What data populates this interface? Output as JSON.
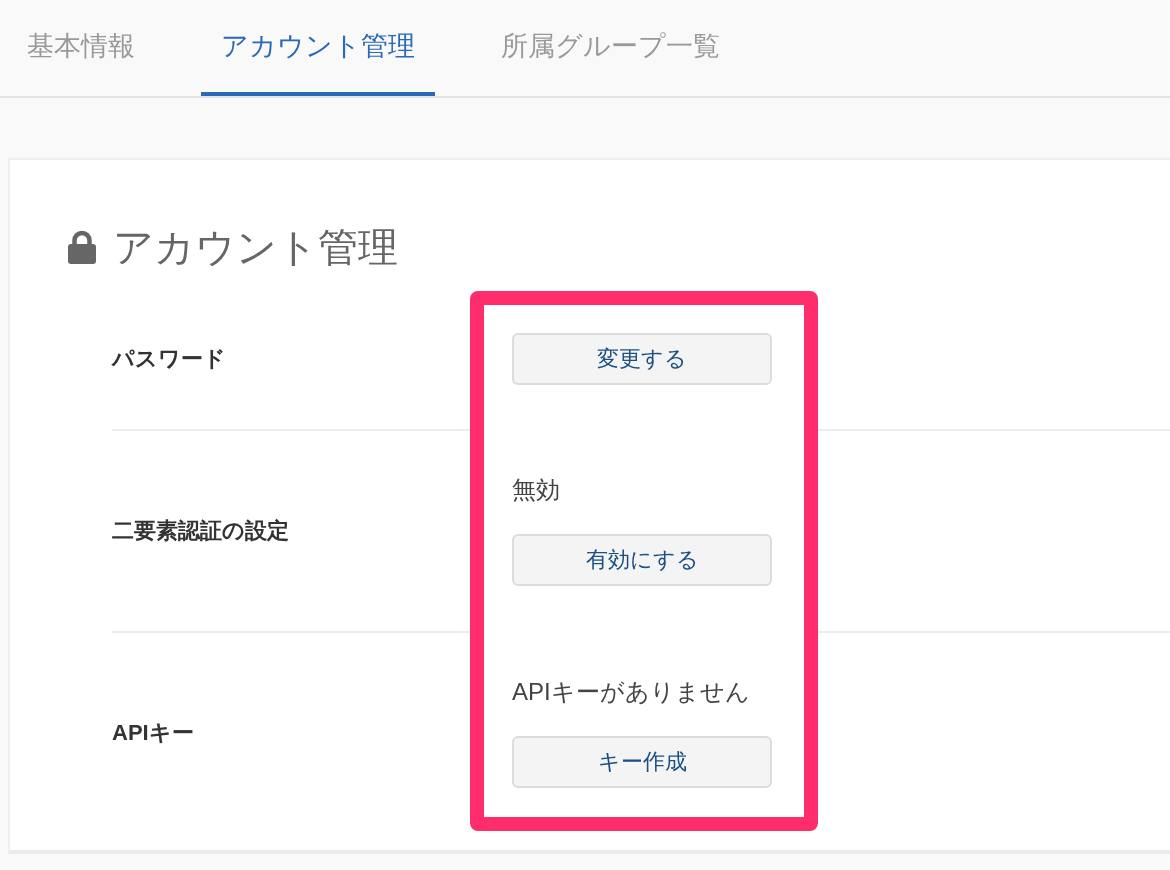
{
  "tabs": [
    {
      "label": "基本情報",
      "selected": false
    },
    {
      "label": "アカウント管理",
      "selected": true
    },
    {
      "label": "所属グループ一覧",
      "selected": false
    }
  ],
  "section": {
    "title": "アカウント管理",
    "rows": [
      {
        "label": "パスワード",
        "button": "変更する"
      },
      {
        "label": "二要素認証の設定",
        "status": "無効",
        "button": "有効にする"
      },
      {
        "label": "APIキー",
        "status": "APIキーがありません",
        "button": "キー作成"
      }
    ]
  }
}
